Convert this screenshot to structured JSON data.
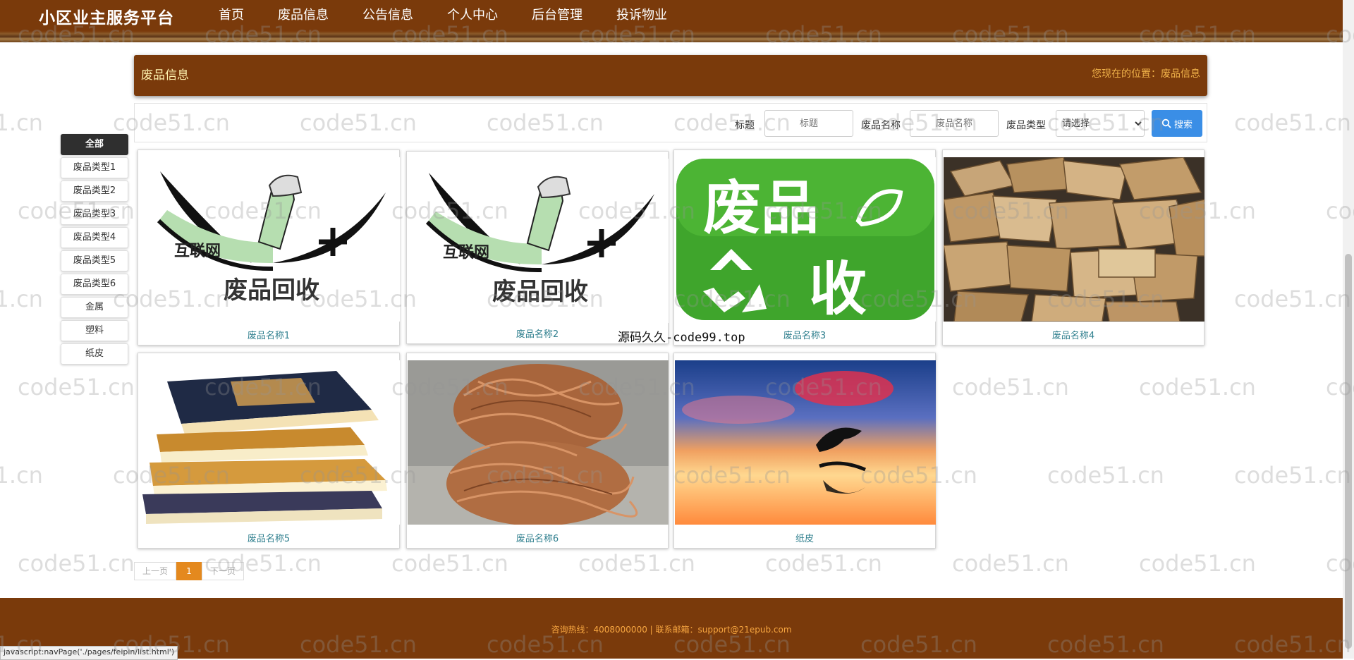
{
  "brand": "小区业主服务平台",
  "nav": [
    "首页",
    "废品信息",
    "公告信息",
    "个人中心",
    "后台管理",
    "投诉物业"
  ],
  "page_header": {
    "title": "废品信息",
    "breadcrumb": "您现在的位置：废品信息"
  },
  "search": {
    "title_label": "标题",
    "title_placeholder": "标题",
    "name_label": "废品名称",
    "name_placeholder": "废品名称",
    "type_label": "废品类型",
    "type_selected": "请选择",
    "button_label": "搜索"
  },
  "categories": [
    "全部",
    "废品类型1",
    "废品类型2",
    "废品类型3",
    "废品类型4",
    "废品类型5",
    "废品类型6",
    "金属",
    "塑料",
    "纸皮"
  ],
  "products": [
    {
      "name": "废品名称1"
    },
    {
      "name": "废品名称2"
    },
    {
      "name": "废品名称3"
    },
    {
      "name": "废品名称4"
    },
    {
      "name": "废品名称5"
    },
    {
      "name": "废品名称6"
    },
    {
      "name": "纸皮"
    }
  ],
  "pager": {
    "prev": "上一页",
    "current": "1",
    "next": "下一页"
  },
  "footer": {
    "info": "咨询热线：4008000000 | 联系邮箱：support@21epub.com"
  },
  "status_url": "javascript:navPage('./pages/feipin/list.html')",
  "overlay": {
    "center_watermark": "源码久久-code99.top",
    "watermark": "code51.cn"
  }
}
